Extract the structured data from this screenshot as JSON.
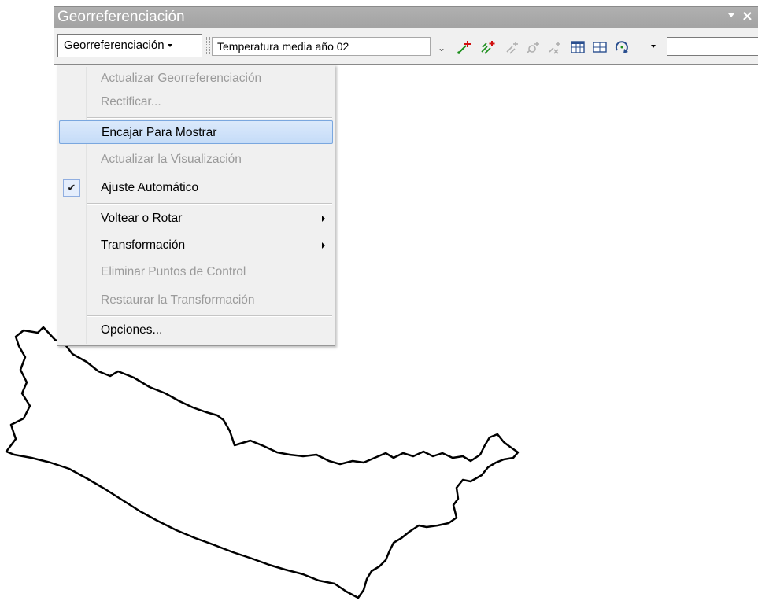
{
  "toolbar": {
    "title": "Georreferenciación",
    "menu_button_label": "Georreferenciación",
    "layer_select_value": "Temperatura media año 02",
    "coordinate_input_value": "",
    "tools": [
      {
        "name": "add-control-points-icon"
      },
      {
        "name": "auto-registration-icon"
      },
      {
        "name": "select-link-icon"
      },
      {
        "name": "zoom-to-selected-link-icon"
      },
      {
        "name": "delete-link-icon"
      },
      {
        "name": "view-link-table-icon"
      },
      {
        "name": "viewer-icon"
      },
      {
        "name": "rotate-icon"
      }
    ]
  },
  "menu": {
    "items": [
      {
        "label": "Actualizar Georreferenciación",
        "enabled": false
      },
      {
        "label": "Rectificar...",
        "enabled": false
      },
      {
        "label": "Encajar Para Mostrar",
        "enabled": true,
        "highlighted": true
      },
      {
        "label": "Actualizar la Visualización",
        "enabled": false
      },
      {
        "label": "Ajuste  Automático",
        "enabled": true,
        "checked": true
      },
      {
        "label": "Voltear o Rotar",
        "enabled": true,
        "submenu": true
      },
      {
        "label": "Transformación",
        "enabled": true,
        "submenu": true
      },
      {
        "label": "Eliminar Puntos de Control",
        "enabled": false
      },
      {
        "label": "Restaurar la Transformación",
        "enabled": false
      },
      {
        "label": "Opciones...",
        "enabled": true
      }
    ]
  },
  "colors": {
    "title_bar": "#a8a8a8",
    "highlight": "#c5dcf8",
    "disabled_text": "#9a9a9a"
  }
}
